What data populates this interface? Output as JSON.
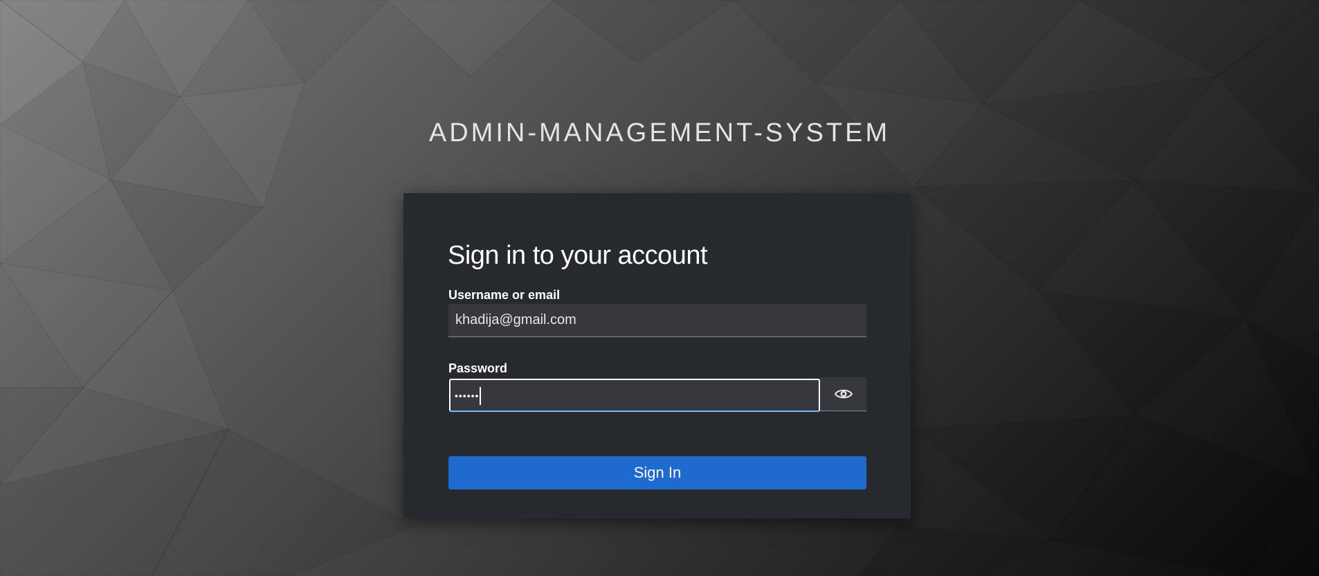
{
  "realm": {
    "title": "ADMIN-MANAGEMENT-SYSTEM"
  },
  "login": {
    "heading": "Sign in to your account",
    "username_label": "Username or email",
    "username_value": "khadija@gmail.com",
    "password_label": "Password",
    "password_masked": "••••••",
    "toggle_icon": "eye-icon",
    "submit_label": "Sign In"
  },
  "colors": {
    "card_background": "#26292d",
    "input_background": "#36383d",
    "primary_button": "#1f6acf",
    "focus_border": "#73bcf7"
  }
}
